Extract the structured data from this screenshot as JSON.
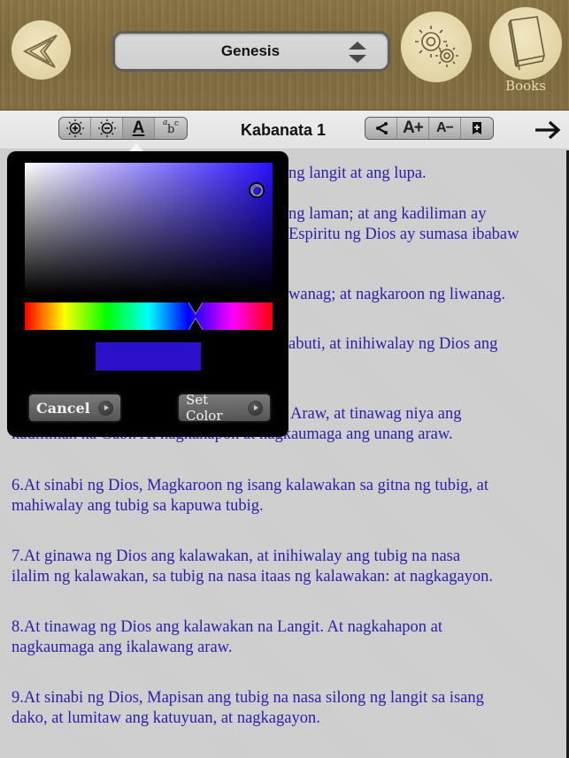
{
  "header": {
    "book_selector": {
      "value": "Genesis"
    },
    "books_label": "Books",
    "icons": {
      "back": "back-arrow-icon",
      "settings": "gears-icon",
      "books": "book-icon",
      "select_arrows": "up-down-icon"
    }
  },
  "toolbar": {
    "left_group": [
      {
        "name": "brightness-up",
        "icon": "brightness-plus-icon"
      },
      {
        "name": "brightness-down",
        "icon": "brightness-minus-icon"
      },
      {
        "name": "text-color",
        "icon": "text-color-icon",
        "glyph": "A",
        "active": true
      },
      {
        "name": "font-style",
        "icon": "font-style-icon",
        "glyph_a": "a",
        "glyph_b": "b",
        "glyph_c": "c"
      }
    ],
    "chapter_title": "Kabanata 1",
    "right_group": [
      {
        "name": "share",
        "icon": "share-icon",
        "glyph": "<"
      },
      {
        "name": "font-increase",
        "icon": "font-increase-icon",
        "glyph": "A+"
      },
      {
        "name": "font-decrease",
        "icon": "font-decrease-icon",
        "glyph": "A−"
      },
      {
        "name": "bookmark",
        "icon": "bookmark-add-icon"
      }
    ],
    "next_icon": "arrow-right-icon"
  },
  "color_picker": {
    "selected_color": "#2a10c8",
    "hue_color": "#2a10ff",
    "cancel_label": "Cancel",
    "set_color_label": "Set Color"
  },
  "content": {
    "text_color": "#2a1fa8",
    "verses": [
      {
        "lines": [
          "ng langit at ang lupa."
        ]
      },
      {
        "lines": [
          "ng laman; at ang kadiliman ay",
          "Espiritu ng Dios ay sumasa ibabaw"
        ]
      },
      {
        "lines": [
          "wanag; at nagkaroon ng liwanag."
        ]
      },
      {
        "lines": [
          "abuti, at inihiwalay ng Dios ang"
        ]
      },
      {
        "lines": [
          "Araw, at tinawag niya ang",
          "kadiliman na Gabi. At nagkahapon at nagkaumaga ang unang araw."
        ]
      },
      {
        "lines": [
          "6.At sinabi ng Dios, Magkaroon ng isang kalawakan sa gitna ng tubig, at",
          "mahiwalay ang tubig sa kapuwa tubig."
        ]
      },
      {
        "lines": [
          "7.At ginawa ng Dios ang kalawakan, at inihiwalay ang tubig na nasa",
          "ilalim ng kalawakan, sa tubig na nasa itaas ng kalawakan: at nagkagayon."
        ]
      },
      {
        "lines": [
          "8.At tinawag ng Dios ang kalawakan na Langit. At nagkahapon at",
          "nagkaumaga ang ikalawang araw."
        ]
      },
      {
        "lines": [
          "9.At sinabi ng Dios, Mapisan ang tubig na nasa silong ng langit sa isang",
          "dako, at lumitaw ang katuyuan, at nagkagayon."
        ]
      }
    ]
  }
}
